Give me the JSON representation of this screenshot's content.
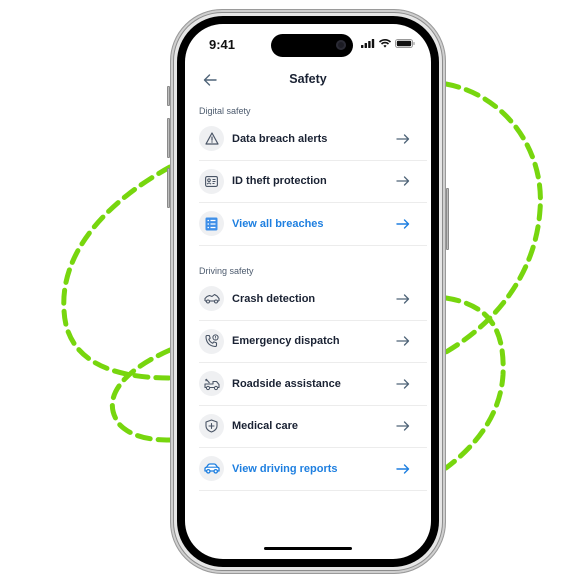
{
  "status_bar": {
    "time": "9:41",
    "icons": [
      "cellular-signal-icon",
      "wifi-icon",
      "battery-icon"
    ]
  },
  "header": {
    "back_icon": "arrow-left-icon",
    "title": "Safety"
  },
  "sections": [
    {
      "label": "Digital safety",
      "items": [
        {
          "label": "Data breach alerts",
          "icon": "warning-triangle-icon",
          "link": false,
          "trailing_icon": "arrow-right-icon"
        },
        {
          "label": "ID theft protection",
          "icon": "id-card-icon",
          "link": false,
          "trailing_icon": "arrow-right-icon"
        },
        {
          "label": "View all breaches",
          "icon": "list-report-icon",
          "link": true,
          "trailing_icon": "arrow-right-icon"
        }
      ]
    },
    {
      "label": "Driving safety",
      "items": [
        {
          "label": "Crash detection",
          "icon": "car-crash-icon",
          "link": false,
          "trailing_icon": "arrow-right-icon"
        },
        {
          "label": "Emergency dispatch",
          "icon": "phone-alert-icon",
          "link": false,
          "trailing_icon": "arrow-right-icon"
        },
        {
          "label": "Roadside assistance",
          "icon": "tow-truck-icon",
          "link": false,
          "trailing_icon": "arrow-right-icon"
        },
        {
          "label": "Medical care",
          "icon": "medical-shield-icon",
          "link": false,
          "trailing_icon": "arrow-right-icon"
        },
        {
          "label": "View driving reports",
          "icon": "car-icon",
          "link": true,
          "trailing_icon": "arrow-right-icon"
        }
      ]
    }
  ],
  "colors": {
    "accent": "#1e7fe0",
    "text_primary": "#1a2233",
    "section_label": "#4d5b6e",
    "icon_bg": "#eff0f2",
    "icon_stroke": "#4a5566",
    "arrow": "#4f6478",
    "swirl": "#7ed321"
  }
}
